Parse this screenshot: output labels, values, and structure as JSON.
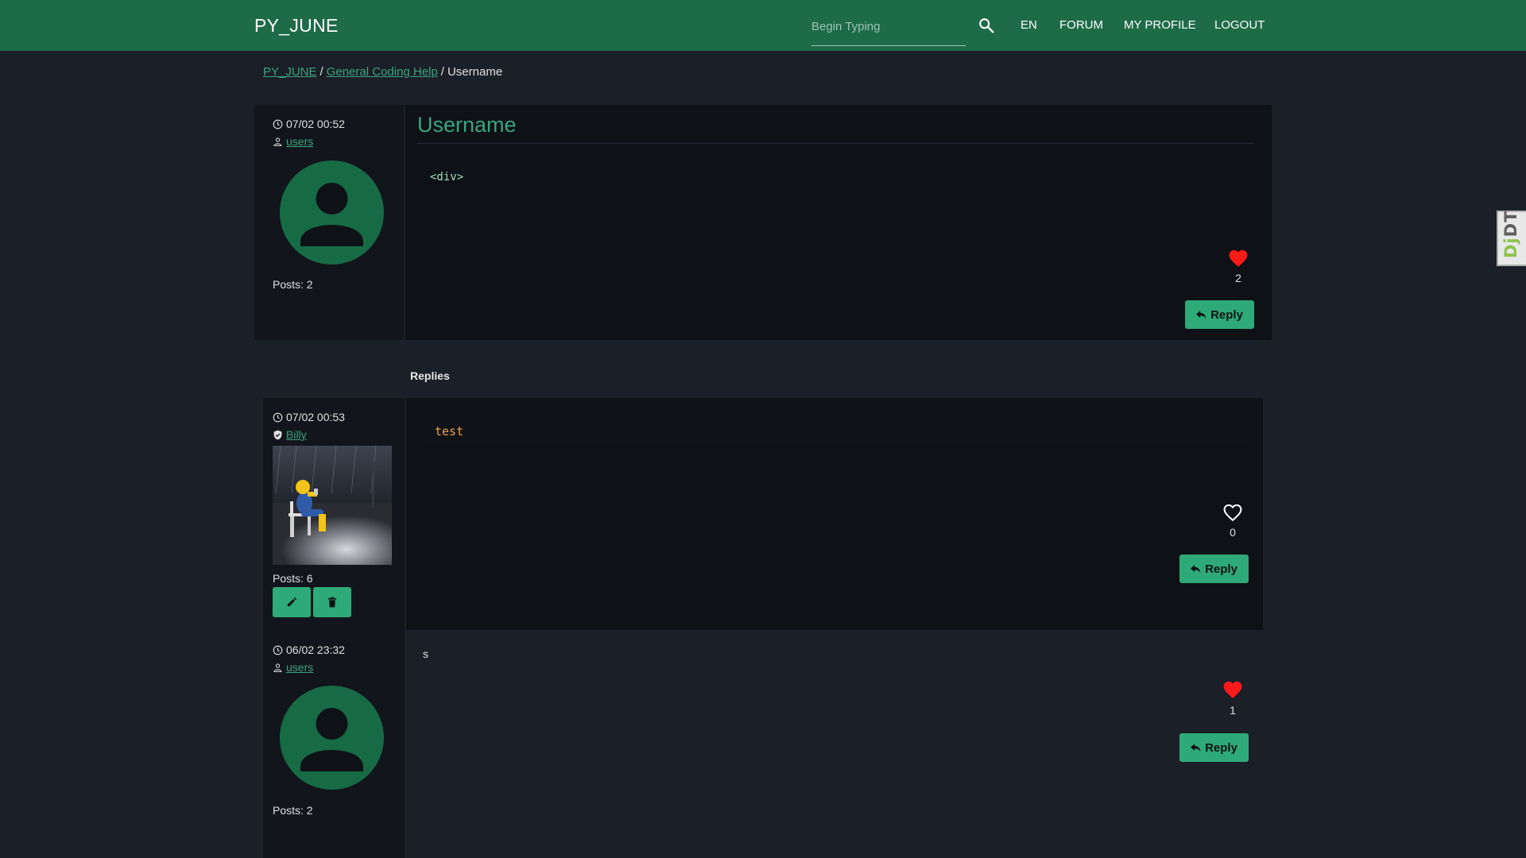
{
  "navbar": {
    "brand": "PY_JUNE",
    "search_placeholder": "Begin Typing",
    "items": [
      "EN",
      "FORUM",
      "MY PROFILE",
      "LOGOUT"
    ]
  },
  "breadcrumb": {
    "root": "PY_JUNE",
    "category": "General Coding Help",
    "current": "Username"
  },
  "main_post": {
    "datetime": "07/02 00:52",
    "author": "users",
    "posts_label": "Posts: 2",
    "title": "Username",
    "body_code": "<div>",
    "likes": "2",
    "liked": true,
    "reply_label": "Reply"
  },
  "replies_heading": "Replies",
  "replies": [
    {
      "datetime": "07/02 00:53",
      "author": "Billy",
      "author_badge": "shield-check-icon",
      "posts_label": "Posts: 6",
      "body_code": "test",
      "likes": "0",
      "liked": false,
      "reply_label": "Reply"
    },
    {
      "datetime": "06/02 23:32",
      "author": "users",
      "posts_label": "Posts: 2",
      "body_text": "s",
      "likes": "1",
      "liked": true,
      "reply_label": "Reply"
    }
  ],
  "debug_toolbar": {
    "label_a": "Dj",
    "label_b": "DT"
  },
  "colors": {
    "navbar": "#1e6b47",
    "accent": "#3aa57e",
    "button": "#2eaa78",
    "heart": "#ff1a1a",
    "background": "#1b1f27"
  }
}
